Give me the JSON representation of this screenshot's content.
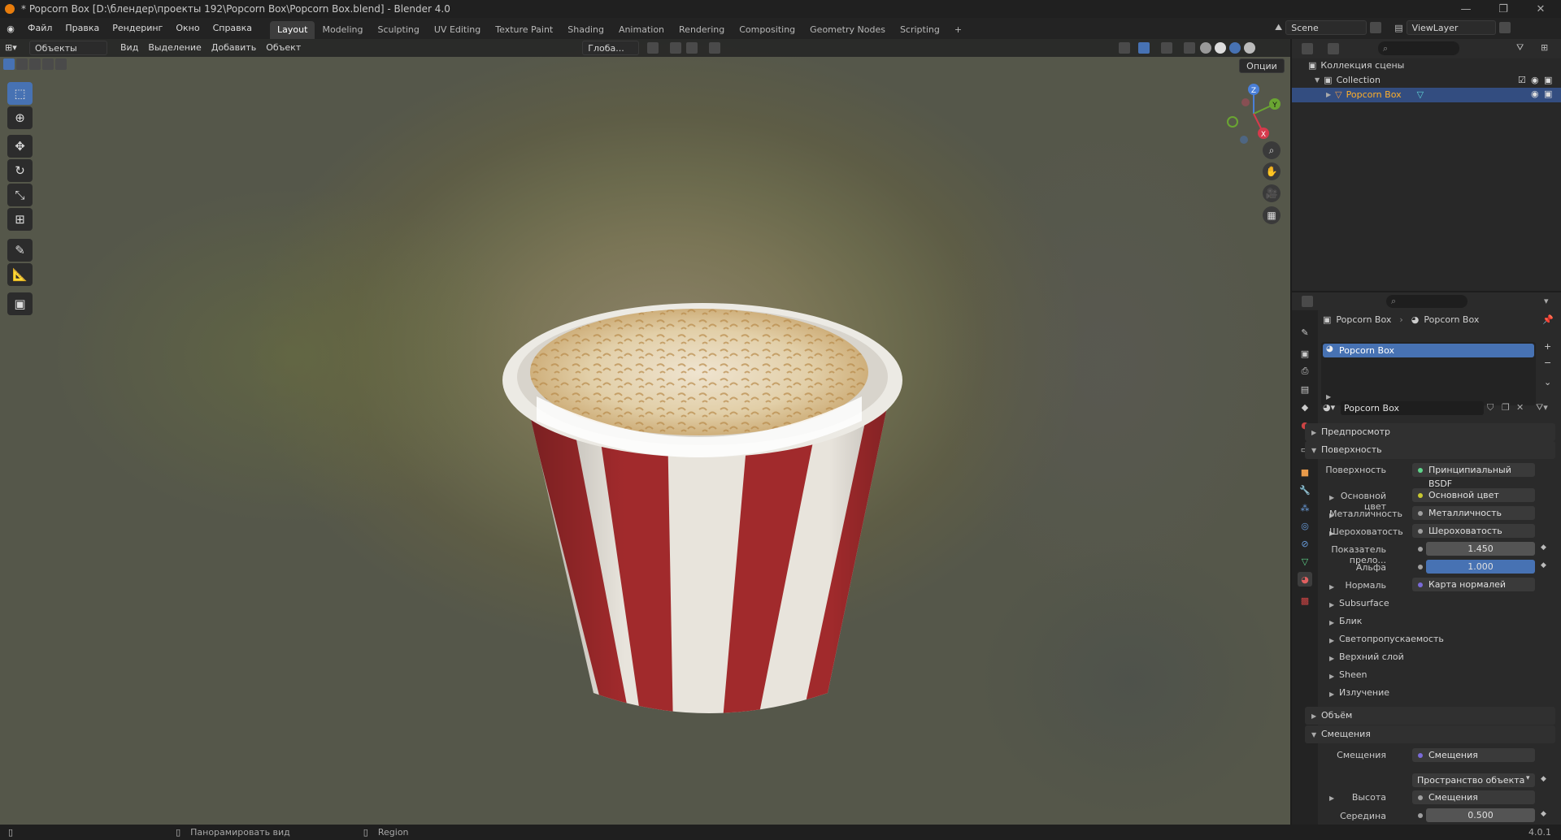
{
  "window": {
    "title": "* Popcorn Box [D:\\блендер\\проекты 192\\Popcorn Box\\Popcorn Box.blend] - Blender 4.0",
    "controls": [
      "—",
      "❐",
      "✕"
    ]
  },
  "menu": [
    "Файл",
    "Правка",
    "Рендеринг",
    "Окно",
    "Справка"
  ],
  "workspaces": [
    {
      "label": "Layout",
      "active": true
    },
    {
      "label": "Modeling"
    },
    {
      "label": "Sculpting"
    },
    {
      "label": "UV Editing"
    },
    {
      "label": "Texture Paint"
    },
    {
      "label": "Shading"
    },
    {
      "label": "Animation"
    },
    {
      "label": "Rendering"
    },
    {
      "label": "Compositing"
    },
    {
      "label": "Geometry Nodes"
    },
    {
      "label": "Scripting"
    }
  ],
  "add_workspace": "+",
  "scene": {
    "name": "Scene",
    "view_layer": "ViewLayer"
  },
  "viewport_header": {
    "mode": "Объекты",
    "menus": [
      "Вид",
      "Выделение",
      "Добавить",
      "Объект"
    ],
    "orientation": "Глоба...",
    "options": "Опции"
  },
  "gizmo": {
    "z": "Z",
    "y": "Y",
    "x": "X"
  },
  "outliner": {
    "root": "Коллекция сцены",
    "collection": "Collection",
    "object": "Popcorn Box"
  },
  "properties": {
    "breadcrumb_object": "Popcorn Box",
    "breadcrumb_material": "Popcorn Box",
    "slot": "Popcorn Box",
    "material_name": "Popcorn Box",
    "sections": {
      "preview": "Предпросмотр",
      "surface": "Поверхность",
      "volume": "Объём",
      "displacement": "Смещения"
    },
    "surface_label": "Поверхность",
    "surface_value": "Принципиальный BSDF",
    "inputs": [
      {
        "label": "Основной цвет",
        "value": "Основной цвет",
        "color": "#c8c830"
      },
      {
        "label": "Металличность",
        "value": "Металличность",
        "color": "#a0a0a0"
      },
      {
        "label": "Шероховатость",
        "value": "Шероховатость",
        "color": "#a0a0a0"
      }
    ],
    "ior_label": "Показатель прело...",
    "ior_value": "1.450",
    "alpha_label": "Альфа",
    "alpha_value": "1.000",
    "normal_label": "Нормаль",
    "normal_value": "Карта нормалей",
    "subpanels": [
      "Subsurface",
      "Блик",
      "Светопропускаемость",
      "Верхний слой",
      "Sheen",
      "Излучение"
    ],
    "disp_label": "Смещения",
    "disp_value": "Смещения",
    "space_value": "Пространство объекта",
    "height_label": "Высота",
    "height_value": "Смещения",
    "mid_label": "Середина",
    "mid_value": "0.500"
  },
  "statusbar": {
    "hint": "Панорамировать вид",
    "region": "Region",
    "version": "4.0.1"
  }
}
